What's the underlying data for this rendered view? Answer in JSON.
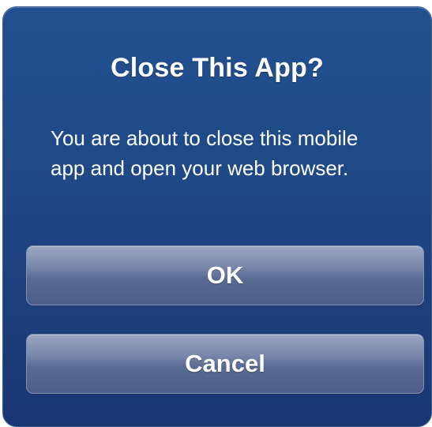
{
  "dialog": {
    "title": "Close This App?",
    "message": "You are about to close this mobile app and open your web browser.",
    "ok_label": "OK",
    "cancel_label": "Cancel"
  },
  "colors": {
    "dialog_background": "#1f4a88",
    "button_background": "#6a7aa0",
    "text": "#ffffff"
  }
}
